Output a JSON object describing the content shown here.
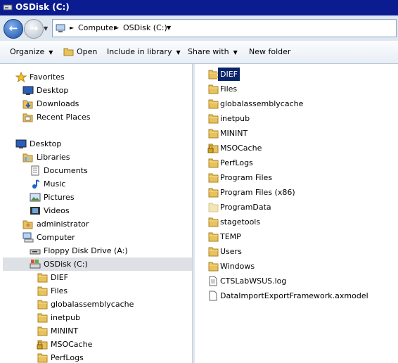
{
  "window": {
    "title": "OSDisk (C:)"
  },
  "address": {
    "crumbs": [
      "Computer",
      "OSDisk (C:)"
    ]
  },
  "toolbar": {
    "organize": "Organize",
    "open": "Open",
    "include_in_library": "Include in library",
    "share_with": "Share with",
    "new_folder": "New folder"
  },
  "nav": {
    "favorites": "Favorites",
    "desktop_fav": "Desktop",
    "downloads": "Downloads",
    "recent_places": "Recent Places",
    "desktop": "Desktop",
    "libraries": "Libraries",
    "documents": "Documents",
    "music": "Music",
    "pictures": "Pictures",
    "videos": "Videos",
    "administrator": "administrator",
    "computer": "Computer",
    "floppy": "Floppy Disk Drive (A:)",
    "osdisk": "OSDisk (C:)",
    "children": [
      "DIEF",
      "Files",
      "globalassemblycache",
      "inetpub",
      "MININT",
      "MSOCache",
      "PerfLogs"
    ]
  },
  "files": [
    {
      "name": "DIEF",
      "icon": "folder-icon"
    },
    {
      "name": "Files",
      "icon": "folder-icon"
    },
    {
      "name": "globalassemblycache",
      "icon": "folder-icon"
    },
    {
      "name": "inetpub",
      "icon": "folder-icon"
    },
    {
      "name": "MININT",
      "icon": "folder-icon"
    },
    {
      "name": "MSOCache",
      "icon": "locked-folder-icon"
    },
    {
      "name": "PerfLogs",
      "icon": "folder-icon"
    },
    {
      "name": "Program Files",
      "icon": "folder-icon"
    },
    {
      "name": "Program Files (x86)",
      "icon": "folder-icon"
    },
    {
      "name": "ProgramData",
      "icon": "hidden-folder-icon"
    },
    {
      "name": "stagetools",
      "icon": "folder-icon"
    },
    {
      "name": "TEMP",
      "icon": "folder-icon"
    },
    {
      "name": "Users",
      "icon": "folder-icon"
    },
    {
      "name": "Windows",
      "icon": "folder-icon"
    },
    {
      "name": "CTSLabWSUS.log",
      "icon": "text-file-icon"
    },
    {
      "name": "DataImportExportFramework.axmodel",
      "icon": "blank-file-icon"
    }
  ],
  "colors": {
    "title_bar": "#0a1c8f",
    "selection": "#0a246a",
    "folder": "#e8c25b"
  }
}
